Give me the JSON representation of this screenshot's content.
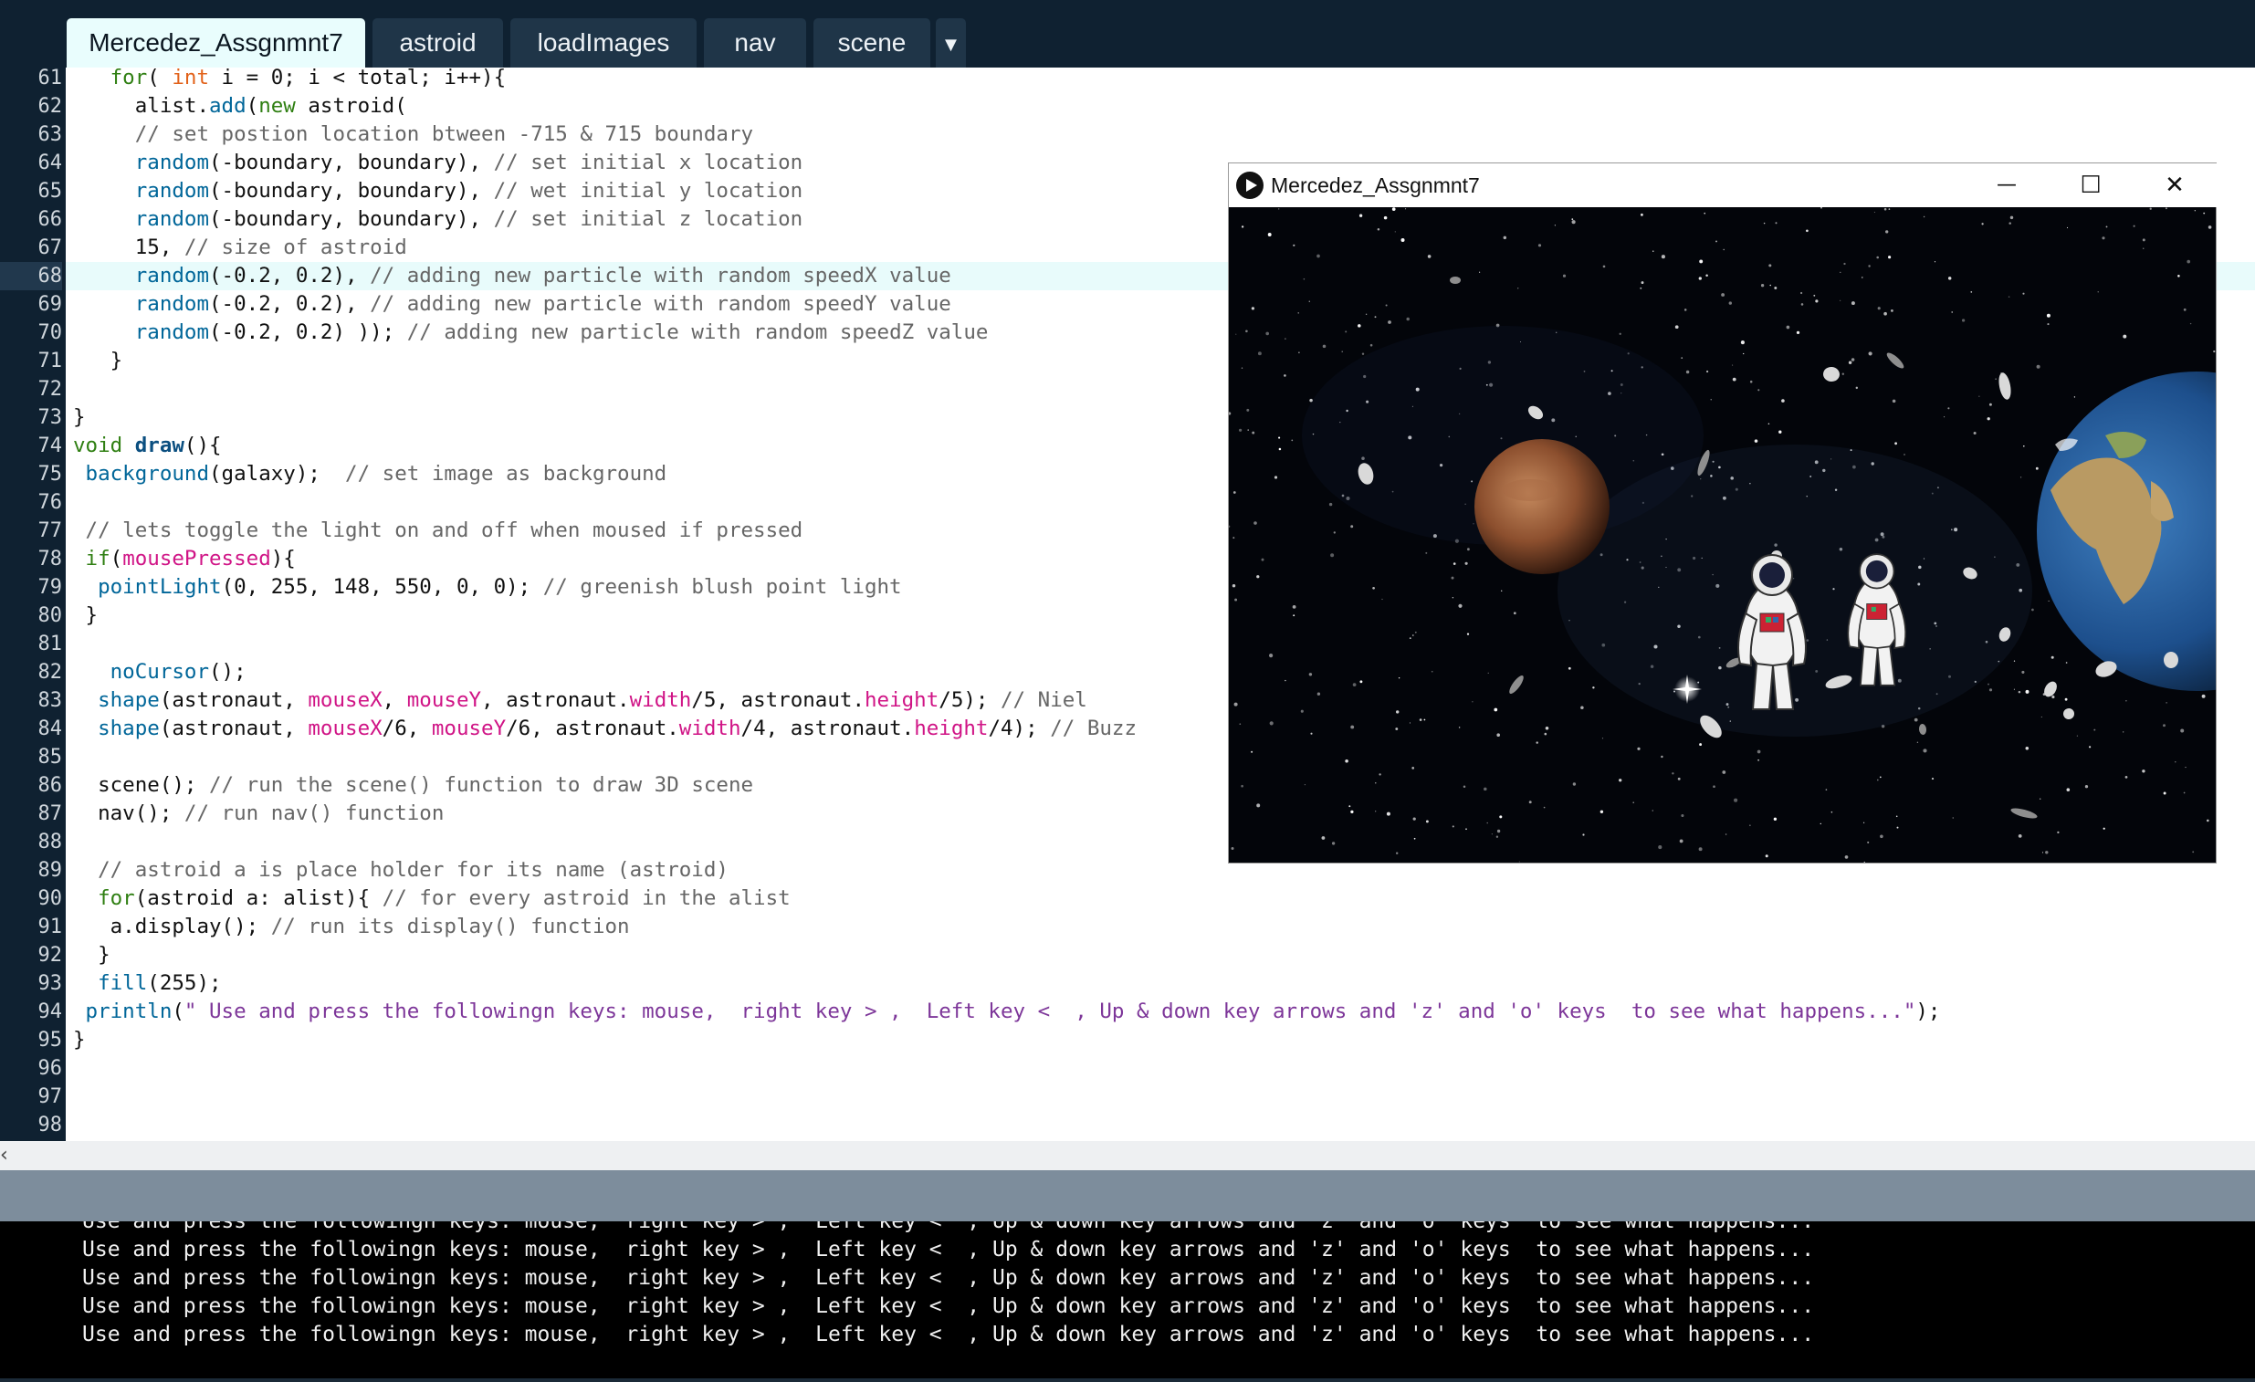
{
  "tabs": [
    {
      "label": "Mercedez_Assgnmnt7",
      "active": true
    },
    {
      "label": "astroid",
      "active": false
    },
    {
      "label": "loadImages",
      "active": false
    },
    {
      "label": "nav",
      "active": false
    },
    {
      "label": "scene",
      "active": false
    }
  ],
  "tab_overflow": "▼",
  "editor": {
    "current_line": 68,
    "lines": [
      {
        "n": "61",
        "code": "   for( int i = 0; i < total; i++){"
      },
      {
        "n": "62",
        "code": "     alist.add(new astroid("
      },
      {
        "n": "63",
        "code": "     // set postion location btween -715 & 715 boundary"
      },
      {
        "n": "64",
        "code": "     random(-boundary, boundary), // set initial x location"
      },
      {
        "n": "65",
        "code": "     random(-boundary, boundary), // wet initial y location"
      },
      {
        "n": "66",
        "code": "     random(-boundary, boundary), // set initial z location"
      },
      {
        "n": "67",
        "code": "     15, // size of astroid"
      },
      {
        "n": "68",
        "code": "     random(-0.2, 0.2), // adding new particle with random speedX value"
      },
      {
        "n": "69",
        "code": "     random(-0.2, 0.2), // adding new particle with random speedY value"
      },
      {
        "n": "70",
        "code": "     random(-0.2, 0.2) )); // adding new particle with random speedZ value"
      },
      {
        "n": "71",
        "code": "   }"
      },
      {
        "n": "72",
        "code": ""
      },
      {
        "n": "73",
        "code": "}"
      },
      {
        "n": "74",
        "code": "void draw(){"
      },
      {
        "n": "75",
        "code": " background(galaxy);  // set image as background"
      },
      {
        "n": "76",
        "code": ""
      },
      {
        "n": "77",
        "code": " // lets toggle the light on and off when moused if pressed"
      },
      {
        "n": "78",
        "code": " if(mousePressed){"
      },
      {
        "n": "79",
        "code": "  pointLight(0, 255, 148, 550, 0, 0); // greenish blush point light"
      },
      {
        "n": "80",
        "code": " }"
      },
      {
        "n": "81",
        "code": ""
      },
      {
        "n": "82",
        "code": "   noCursor();"
      },
      {
        "n": "83",
        "code": "  shape(astronaut, mouseX, mouseY, astronaut.width/5, astronaut.height/5); // Niel"
      },
      {
        "n": "84",
        "code": "  shape(astronaut, mouseX/6, mouseY/6, astronaut.width/4, astronaut.height/4); // Buzz"
      },
      {
        "n": "85",
        "code": ""
      },
      {
        "n": "86",
        "code": "  scene(); // run the scene() function to draw 3D scene"
      },
      {
        "n": "87",
        "code": "  nav(); // run nav() function"
      },
      {
        "n": "88",
        "code": ""
      },
      {
        "n": "89",
        "code": "  // astroid a is place holder for its name (astroid)"
      },
      {
        "n": "90",
        "code": "  for(astroid a: alist){ // for every astroid in the alist"
      },
      {
        "n": "91",
        "code": "   a.display(); // run its display() function"
      },
      {
        "n": "92",
        "code": "  }"
      },
      {
        "n": "93",
        "code": "  fill(255);"
      },
      {
        "n": "94",
        "code": " println(\" Use and press the followingn keys: mouse,  right key > ,  Left key <  , Up & down key arrows and 'z' and 'o' keys  to see what happens...\");"
      },
      {
        "n": "95",
        "code": "}"
      },
      {
        "n": "96",
        "code": ""
      },
      {
        "n": "97",
        "code": ""
      },
      {
        "n": "98",
        "code": ""
      }
    ]
  },
  "scroll_arrow": "‹",
  "console": {
    "lines": [
      "Use and press the followingn keys: mouse,  right key > ,  Left key <  , Up & down key arrows and 'z' and 'o' keys  to see what happens...",
      "Use and press the followingn keys: mouse,  right key > ,  Left key <  , Up & down key arrows and 'z' and 'o' keys  to see what happens...",
      "Use and press the followingn keys: mouse,  right key > ,  Left key <  , Up & down key arrows and 'z' and 'o' keys  to see what happens...",
      "Use and press the followingn keys: mouse,  right key > ,  Left key <  , Up & down key arrows and 'z' and 'o' keys  to see what happens...",
      "Use and press the followingn keys: mouse,  right key > ,  Left key <  , Up & down key arrows and 'z' and 'o' keys  to see what happens..."
    ]
  },
  "sketch_window": {
    "title": "Mercedez_Assgnmnt7",
    "minimize": "—",
    "maximize": "☐",
    "close": "✕",
    "icon": "processing-play-icon"
  },
  "colors": {
    "ide_dark": "#0f2131",
    "tab_active": "#e9fdfd",
    "comment": "#666666",
    "keyword": "#2f7f12",
    "function": "#006699",
    "string": "#7d3699",
    "builtin_var": "#d01486"
  }
}
